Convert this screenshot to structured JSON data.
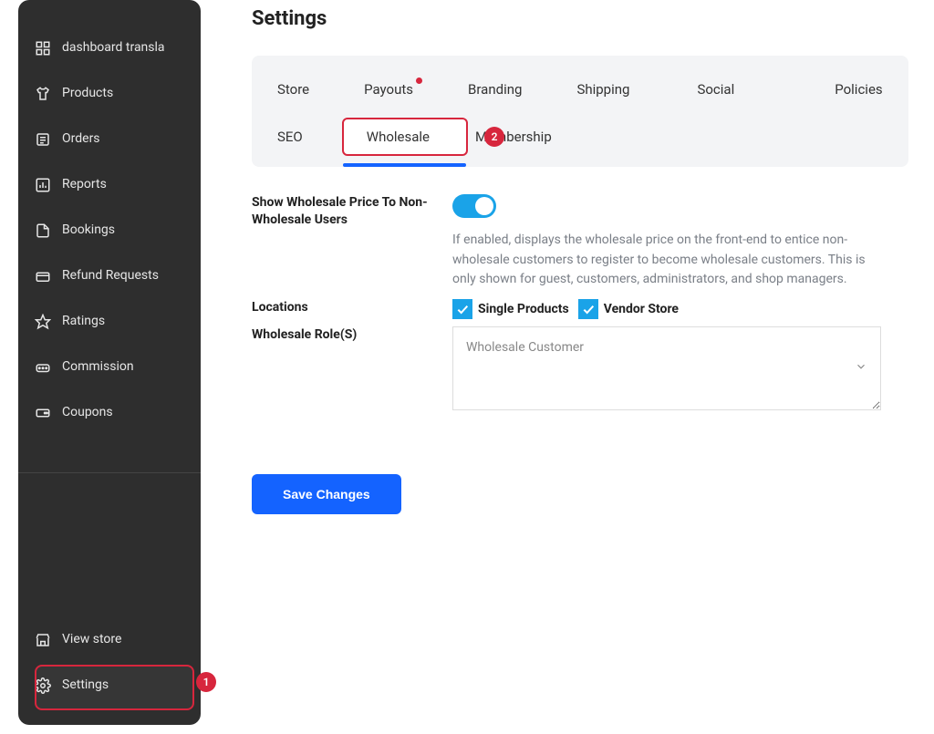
{
  "sidebar": {
    "items": [
      {
        "label": "dashboard transla"
      },
      {
        "label": "Products"
      },
      {
        "label": "Orders"
      },
      {
        "label": "Reports"
      },
      {
        "label": "Bookings"
      },
      {
        "label": "Refund Requests"
      },
      {
        "label": "Ratings"
      },
      {
        "label": "Commission"
      },
      {
        "label": "Coupons"
      }
    ],
    "bottom": [
      {
        "label": "View store"
      },
      {
        "label": "Settings"
      }
    ],
    "highlight_badge": "1"
  },
  "page": {
    "title": "Settings"
  },
  "tabs": {
    "row1": [
      "Store",
      "Payouts",
      "Branding",
      "Shipping",
      "Social",
      "Policies"
    ],
    "row2": [
      "SEO",
      "Wholesale",
      "Membership"
    ],
    "active": "Wholesale",
    "badge2": "2"
  },
  "settings": {
    "show_price_label": "Show Wholesale Price To Non-Wholesale Users",
    "show_price_help": "If enabled, displays the wholesale price on the front-end to entice non-wholesale customers to register to become wholesale customers. This is only shown for guest, customers, administrators, and shop managers.",
    "locations_label": "Locations",
    "locations_opts": {
      "single": "Single Products",
      "store": "Vendor Store"
    },
    "roles_label": "Wholesale Role(S)",
    "roles_selected": "Wholesale Customer"
  },
  "actions": {
    "save": "Save Changes"
  }
}
